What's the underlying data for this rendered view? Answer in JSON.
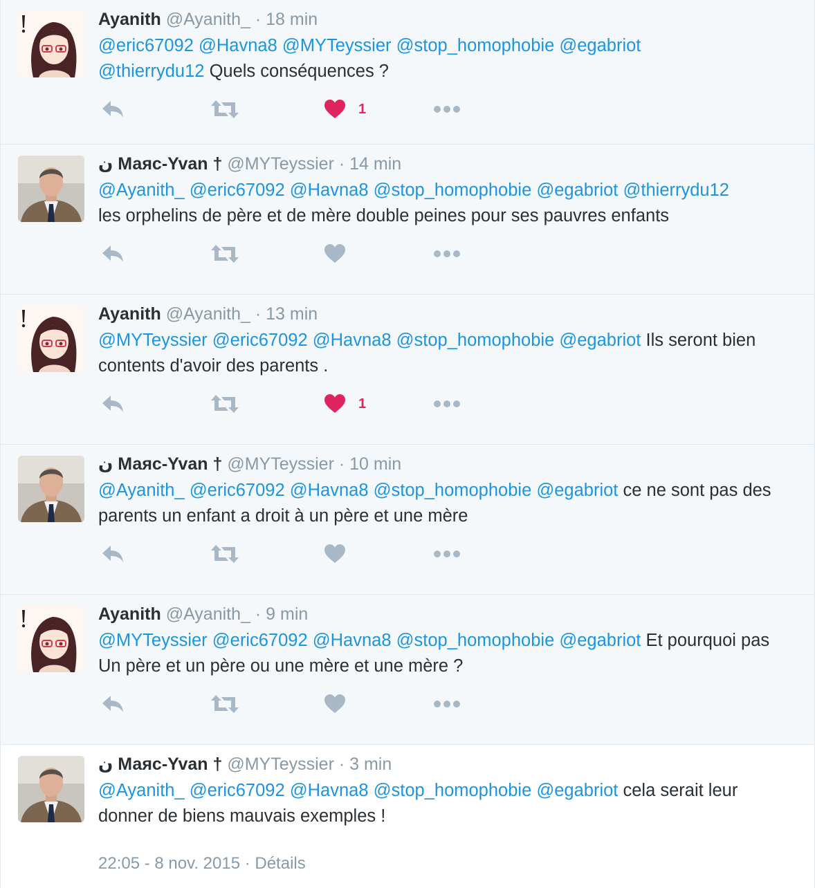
{
  "colors": {
    "mention": "#1b95e0",
    "like": "#e0245e",
    "muted": "#8899a6",
    "action": "#a8b8c6"
  },
  "icons": {
    "reply": "reply-icon",
    "retweet": "retweet-icon",
    "like": "heart-icon",
    "more": "more-dots-icon"
  },
  "tweets": [
    {
      "author": "Ayanith",
      "handle": "@Ayanith_",
      "sep": " · ",
      "time": "18 min",
      "mentions": [
        "@eric67092",
        "@Havna8",
        "@MYTeyssier",
        "@stop_homophobie",
        "@egabriot",
        "@thierrydu12"
      ],
      "text": "Quels conséquences ?",
      "liked": true,
      "likes": "1"
    },
    {
      "author": "Маяс-Yvan †",
      "author_prefix": "ن",
      "handle": "@MYTeyssier",
      "sep": " · ",
      "time": "14 min",
      "mentions": [
        "@Ayanith_",
        "@eric67092",
        "@Havna8",
        "@stop_homophobie",
        "@egabriot",
        "@thierrydu12"
      ],
      "text": "les orphelins de père et de mère double peines pour ses pauvres enfants",
      "liked": false,
      "likes": ""
    },
    {
      "author": "Ayanith",
      "handle": "@Ayanith_",
      "sep": " · ",
      "time": "13 min",
      "mentions": [
        "@MYTeyssier",
        "@eric67092",
        "@Havna8",
        "@stop_homophobie",
        "@egabriot"
      ],
      "text": "Ils seront bien contents d'avoir des parents .",
      "liked": true,
      "likes": "1"
    },
    {
      "author": "Маяс-Yvan †",
      "author_prefix": "ن",
      "handle": "@MYTeyssier",
      "sep": " · ",
      "time": "10 min",
      "mentions": [
        "@Ayanith_",
        "@eric67092",
        "@Havna8",
        "@stop_homophobie",
        "@egabriot"
      ],
      "text": "ce ne sont pas des parents un enfant a droit à un père et une mère",
      "liked": false,
      "likes": ""
    },
    {
      "author": "Ayanith",
      "handle": "@Ayanith_",
      "sep": " · ",
      "time": "9 min",
      "mentions": [
        "@MYTeyssier",
        "@eric67092",
        "@Havna8",
        "@stop_homophobie",
        "@egabriot"
      ],
      "text": "Et pourquoi pas Un père et un père ou une mère et une mère ?",
      "liked": false,
      "likes": ""
    },
    {
      "author": "Маяс-Yvan †",
      "author_prefix": "ن",
      "handle": "@MYTeyssier",
      "sep": " · ",
      "time": "3 min",
      "mentions": [
        "@Ayanith_",
        "@eric67092",
        "@Havna8",
        "@stop_homophobie",
        "@egabriot"
      ],
      "text": "cela serait leur donner de biens mauvais exemples !"
    }
  ],
  "footer": {
    "timestamp": "22:05 - 8 nov. 2015",
    "sep": " · ",
    "details": "Détails"
  }
}
